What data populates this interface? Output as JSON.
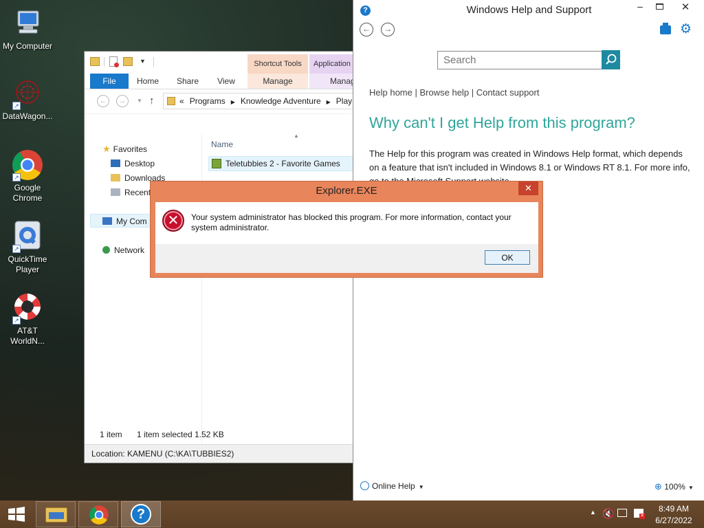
{
  "desktop": {
    "icons": [
      {
        "label": "My Computer"
      },
      {
        "label": "DataWagon..."
      },
      {
        "label": "Google Chrome"
      },
      {
        "label": "QuickTime Player"
      },
      {
        "label": "AT&T WorldN..."
      }
    ]
  },
  "explorer": {
    "context_tabs": {
      "shortcut_tools": "Shortcut Tools",
      "application": "Application"
    },
    "tabs": {
      "file": "File",
      "home": "Home",
      "share": "Share",
      "view": "View",
      "manage1": "Manage",
      "manage2": "Manag"
    },
    "breadcrumb": {
      "prefix": "«",
      "items": [
        "Programs",
        "Knowledge Adventure",
        "Play"
      ]
    },
    "nav": {
      "favorites": "Favorites",
      "desktop": "Desktop",
      "downloads": "Downloads",
      "recent": "Recent",
      "my_computer": "My Com",
      "network": "Network"
    },
    "column_name": "Name",
    "file_item": "Teletubbies 2 - Favorite Games",
    "status": {
      "count": "1 item",
      "selected": "1 item selected",
      "size": "1.52 KB"
    },
    "location": "Location: KAMENU (C:\\KA\\TUBBIES2)"
  },
  "help": {
    "title": "Windows Help and Support",
    "search_placeholder": "Search",
    "links": {
      "home": "Help home",
      "browse": "Browse help",
      "contact": "Contact support",
      "sep": "|"
    },
    "heading": "Why can't I get Help from this program?",
    "body": "The Help for this program was created in Windows Help format, which depends on a feature that isn't included in Windows 8.1 or Windows RT 8.1. For more info, go to the Microsoft Support website.",
    "online_help": "Online Help",
    "zoom": "100%"
  },
  "dialog": {
    "title": "Explorer.EXE",
    "message": "Your system administrator has blocked this program. For more information, contact your system administrator.",
    "ok": "OK"
  },
  "taskbar": {
    "time": "8:49 AM",
    "date": "6/27/2022"
  },
  "colors": {
    "accent_blue": "#1979ca",
    "help_heading": "#2fa59a",
    "dialog_border": "#e9855b",
    "error_red": "#c8102e"
  }
}
